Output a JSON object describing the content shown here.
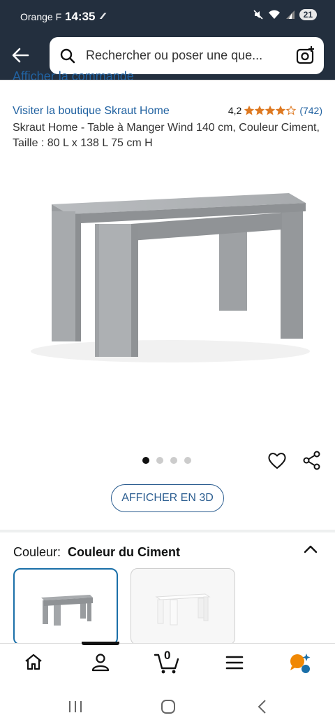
{
  "status_bar": {
    "carrier": "Orange F",
    "time": "14:35",
    "battery": "21"
  },
  "search": {
    "placeholder": "Rechercher ou poser une que..."
  },
  "partial_link": "Afficher la commande",
  "product": {
    "store_link": "Visiter la boutique Skraut Home",
    "rating": "4,2",
    "rating_value": 4.2,
    "review_count": "(742)",
    "title": "Skraut Home - Table à Manger Wind 140 cm, Couleur Ciment, Taille : 80 L x 138 L 75 cm H",
    "image_count": 4,
    "active_image": 1,
    "view_3d_label": "AFFICHER EN 3D"
  },
  "variation": {
    "label": "Couleur:",
    "selected_value": "Couleur du Ciment",
    "options": [
      "cement-grey-table",
      "white-table"
    ]
  },
  "bottom_nav": {
    "items": [
      "home-icon",
      "account-icon",
      "cart-icon",
      "menu-icon",
      "rufus-assistant-icon"
    ],
    "cart_count": "0",
    "active": "account"
  },
  "colors": {
    "header_bg": "#232f3e",
    "link": "#2162a1",
    "star": "#de7921",
    "accent_blue": "#1a6fa8",
    "assistant_orange": "#f08804"
  }
}
